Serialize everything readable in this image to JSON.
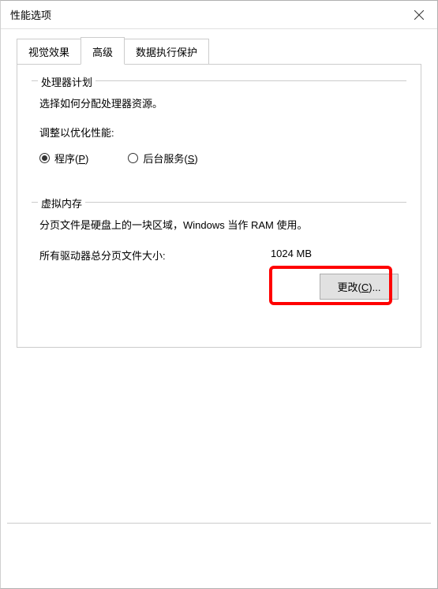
{
  "window": {
    "title": "性能选项"
  },
  "tabs": {
    "visual": "视觉效果",
    "advanced": "高级",
    "dep": "数据执行保护"
  },
  "processor": {
    "group_title": "处理器计划",
    "desc": "选择如何分配处理器资源。",
    "adjust_label": "调整以优化性能:",
    "radio_programs_pre": "程序(",
    "radio_programs_key": "P",
    "radio_programs_post": ")",
    "radio_services_pre": "后台服务(",
    "radio_services_key": "S",
    "radio_services_post": ")"
  },
  "virtual_memory": {
    "group_title": "虚拟内存",
    "desc": "分页文件是硬盘上的一块区域，Windows 当作 RAM 使用。",
    "total_label": "所有驱动器总分页文件大小:",
    "total_value": "1024 MB",
    "change_pre": "更改(",
    "change_key": "C",
    "change_post": ")..."
  }
}
